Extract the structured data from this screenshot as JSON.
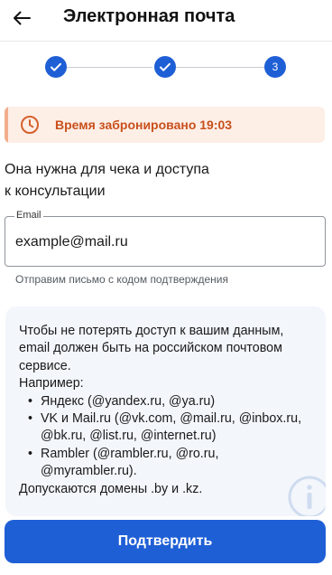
{
  "header": {
    "title": "Электронная почта",
    "back_icon": "arrow-left-icon"
  },
  "stepper": {
    "steps": [
      {
        "state": "completed",
        "icon": "check-icon"
      },
      {
        "state": "completed",
        "icon": "check-icon"
      },
      {
        "state": "current",
        "label": "3"
      }
    ],
    "active_color": "#1f5fd6"
  },
  "timer": {
    "text": "Время забронировано 19:03",
    "icon": "clock-icon",
    "text_color": "#c8501c",
    "background": "#fdeee6"
  },
  "description": {
    "line1": "Она нужна для чека и доступа",
    "line2": "к консультации"
  },
  "email_field": {
    "label": "Email",
    "value": "example@mail.ru",
    "hint": "Отправим письмо с кодом подтверждения"
  },
  "info_box": {
    "intro": "Чтобы не потерять доступ к вашим данным, email должен быть на российском почтовом сервисе.",
    "examples_heading": "Например:",
    "examples": [
      "Яндекс (@yandex.ru, @ya.ru)",
      "VK и Mail.ru (@vk.com, @mail.ru, @inbox.ru, @bk.ru, @list.ru, @internet.ru)",
      "Rambler (@rambler.ru, @ro.ru, @myrambler.ru)."
    ],
    "footer": "Допускаются домены .by и .kz.",
    "icon": "info-icon"
  },
  "confirm_button": {
    "label": "Подтвердить",
    "color": "#1f5fd6"
  }
}
